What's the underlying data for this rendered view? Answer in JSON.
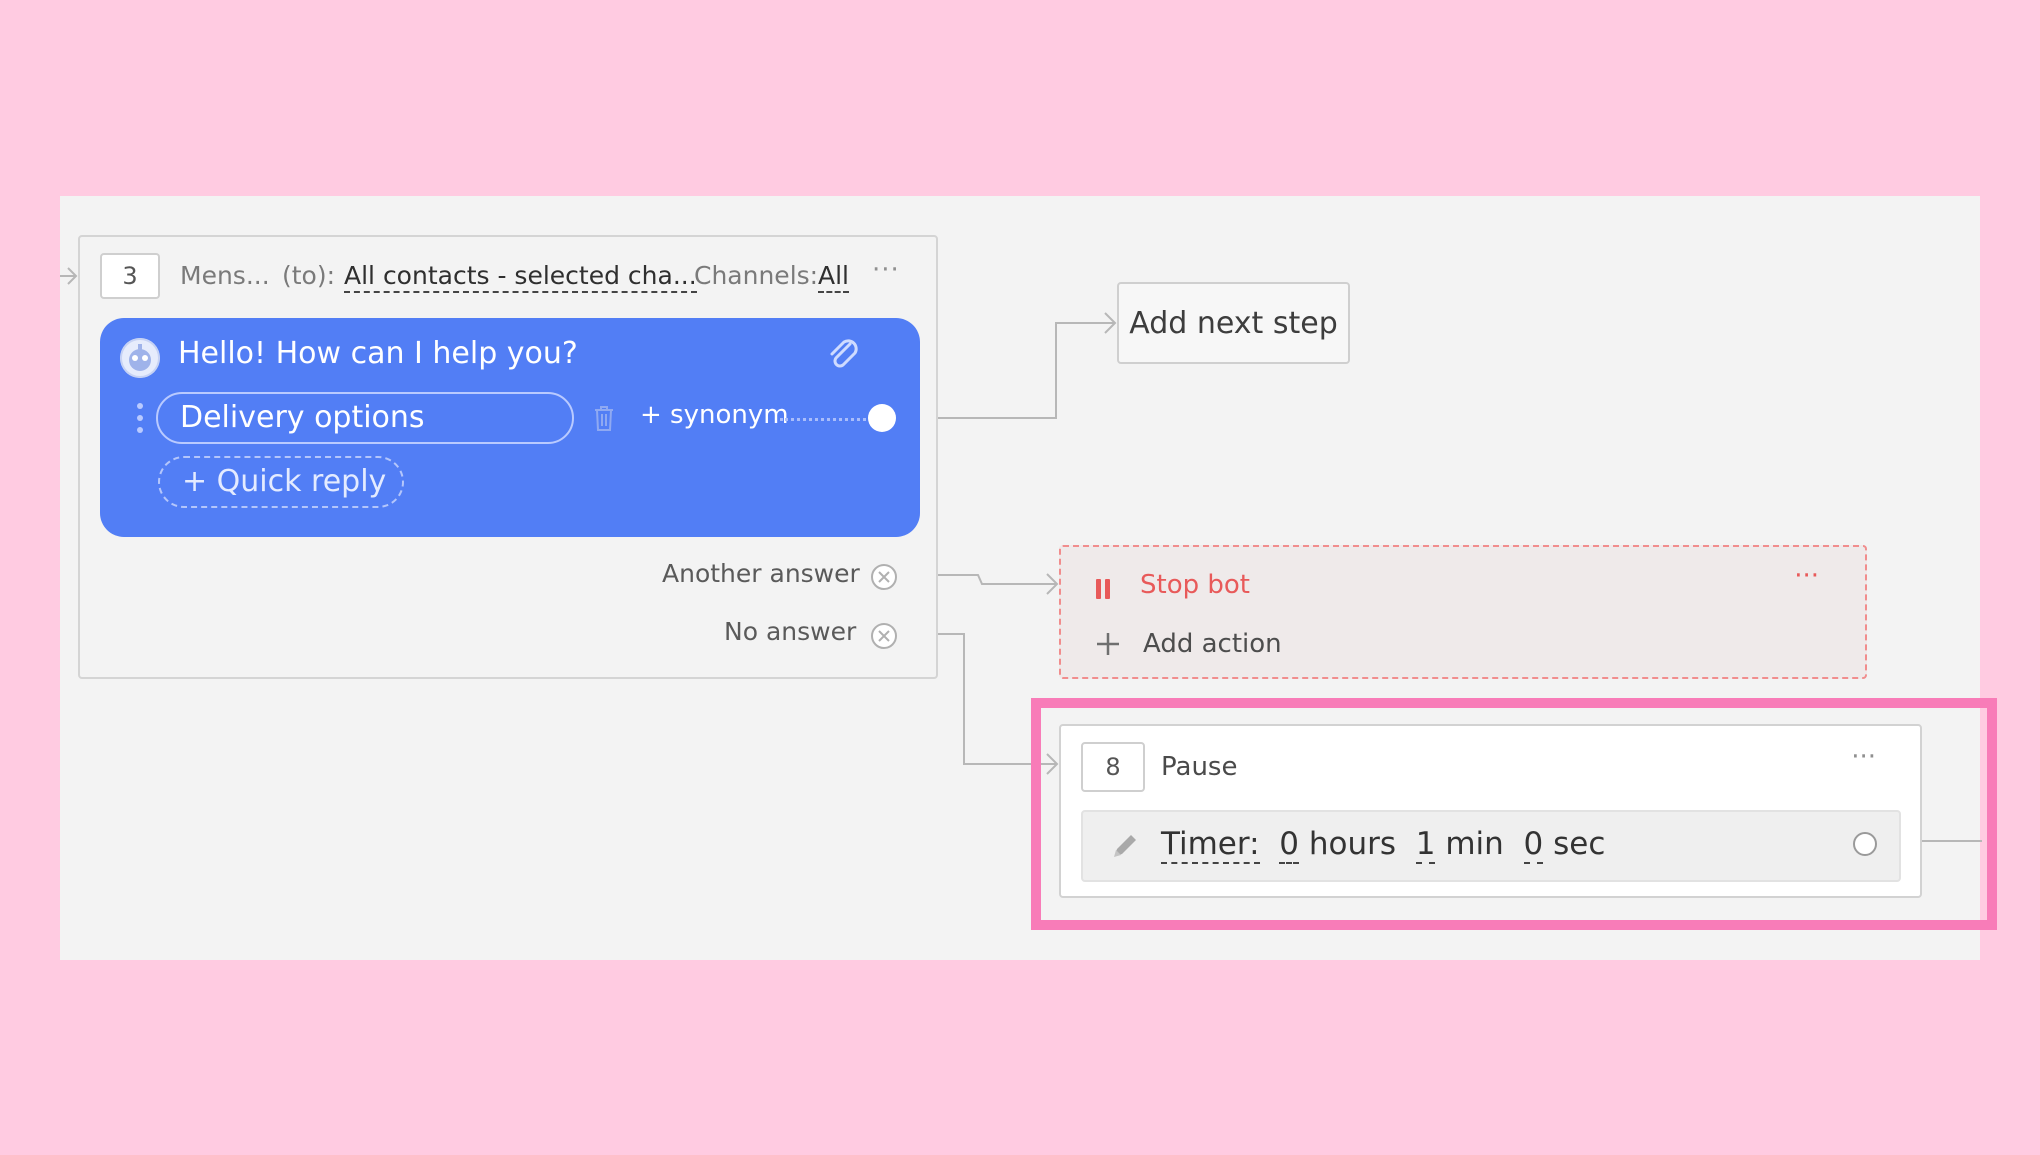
{
  "step3": {
    "number": "3",
    "type_label": "Mens...",
    "to_label": "(to):",
    "to_value": "All contacts - selected cha...",
    "channels_label": "Channels:",
    "channels_value": "All",
    "more": "···",
    "message": "Hello! How can I help you?",
    "quick_reply_button": "Delivery options",
    "synonym_label": "+ synonym",
    "add_quick_reply": "+ Quick reply",
    "another_answer_label": "Another answer",
    "no_answer_label": "No answer"
  },
  "add_next_step": {
    "label": "Add next step"
  },
  "stop_bot": {
    "title": "Stop bot",
    "more": "···",
    "add_action_label": "Add action"
  },
  "pause_step": {
    "number": "8",
    "title": "Pause",
    "more": "···",
    "timer_label": "Timer:",
    "hours_value": "0",
    "hours_unit": "hours",
    "minutes_value": "1",
    "minutes_unit": "min",
    "seconds_value": "0",
    "seconds_unit": "sec"
  },
  "colors": {
    "background": "#ffcbe1",
    "canvas": "#f3f3f3",
    "bubble": "#527ef5",
    "stop_accent": "#e85a5a",
    "highlight": "#f87cb8"
  },
  "icons": [
    "bot-avatar-icon",
    "paperclip-icon",
    "drag-handle-icon",
    "trash-icon",
    "close-circle-icon",
    "pause-icon",
    "plus-icon",
    "pencil-icon"
  ]
}
